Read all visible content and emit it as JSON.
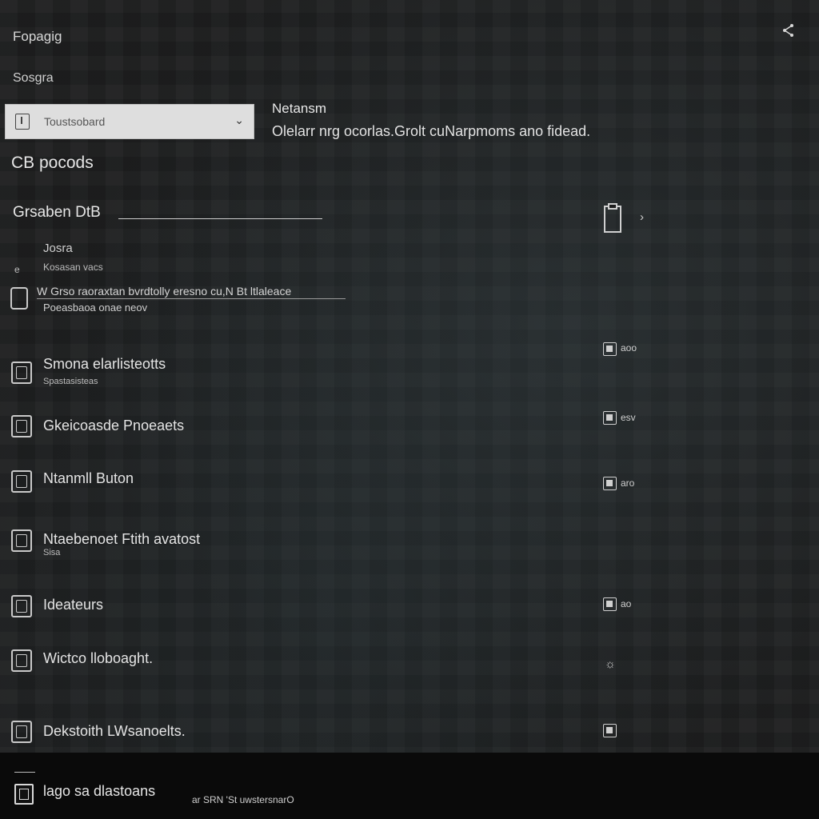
{
  "app": {
    "title": "Fopagig"
  },
  "header": {
    "section_label": "Sosgra"
  },
  "dropdown": {
    "value": "Toustsobard",
    "chevron": "⌄",
    "icon": "file-icon"
  },
  "info": {
    "title": "Netansm",
    "description": "Olelarr nrg ocorlas.Grolt cuNarpmoms ano fidead."
  },
  "products": {
    "heading": "CB pocods"
  },
  "section": {
    "heading": "Grsaben DtB"
  },
  "subsection": {
    "title": "Josra",
    "caption": "Kosasan vacs",
    "icon_text": "e"
  },
  "detail": {
    "line1": "W Grso raoraxtan bvrdtolly eresno cu,N Bt ltlaleace",
    "line2": "Poeasbaoa onae neov"
  },
  "floating_meta": {
    "text": "aoo",
    "icon": "badge-icon"
  },
  "rows": [
    {
      "label": "Smona elarlisteotts",
      "sub": "Spastasisteas",
      "meta": "",
      "icon": "chart-icon"
    },
    {
      "label": "Gkeicoasde Pnoeaets",
      "sub": "",
      "meta": "esv",
      "icon": "check-icon"
    },
    {
      "label": "Ntanmll Buton",
      "sub": "",
      "meta": "aro",
      "icon": "circle-icon"
    },
    {
      "label": "Ntaebenoet Ftith avatost",
      "sub": "Sisa",
      "meta": "",
      "icon": "monitor-icon"
    },
    {
      "label": "Ideateurs",
      "sub": "",
      "meta": "ao",
      "icon": "tag-icon"
    },
    {
      "label": "Wictco lloboaght.",
      "sub": "",
      "meta": "",
      "icon": "camera-icon"
    },
    {
      "label": "Dekstoith LWsanoelts.",
      "sub": "",
      "meta": "",
      "icon": "document-icon"
    }
  ],
  "bottom": {
    "label": "lago sa dlastoans",
    "sub": "ar SRN 'St uwstersnarO",
    "icon": "window-icon"
  },
  "colors": {
    "background": "#1d1d1d",
    "dropdown_bg": "#dedede",
    "bottom_bar": "#0a0a0a"
  }
}
